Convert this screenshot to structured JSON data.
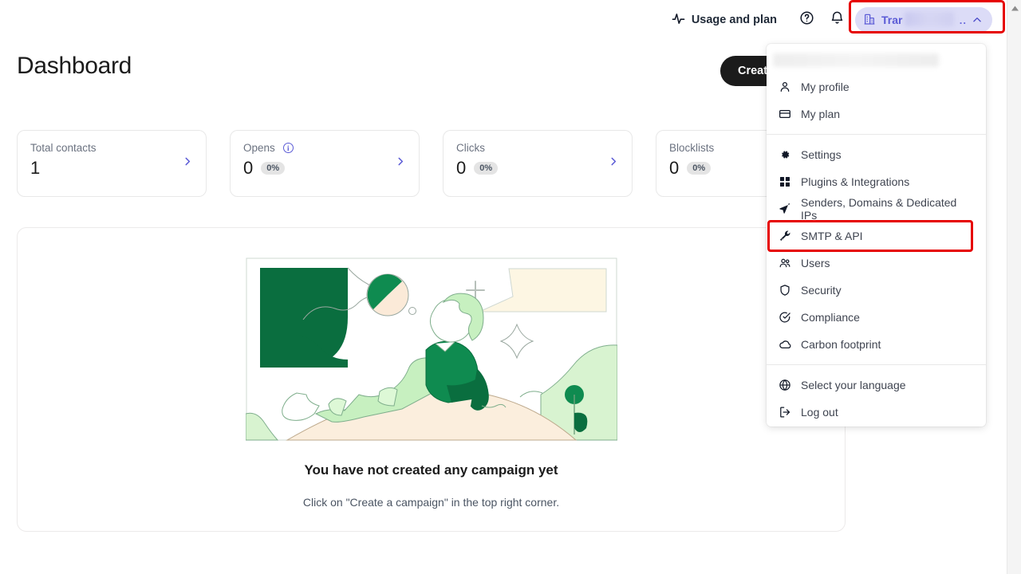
{
  "topbar": {
    "usage_and_plan": "Usage and plan",
    "usage_icon": "activity-pulse-icon",
    "help_icon": "help-circle-icon",
    "notifications_icon": "bell-icon",
    "account": {
      "icon": "company-building-icon",
      "label": "Trar",
      "truncation": "..",
      "caret_icon": "chevron-up-icon",
      "redacted": true
    }
  },
  "page": {
    "title": "Dashboard",
    "create_button": "Create a campaign"
  },
  "stats": [
    {
      "label": "Total contacts",
      "value": "1",
      "percent": null,
      "has_info": false,
      "chevron_icon": "chevron-right-icon"
    },
    {
      "label": "Opens",
      "value": "0",
      "percent": "0%",
      "has_info": true,
      "chevron_icon": "chevron-right-icon"
    },
    {
      "label": "Clicks",
      "value": "0",
      "percent": "0%",
      "has_info": false,
      "chevron_icon": "chevron-right-icon"
    },
    {
      "label": "Blocklists",
      "value": "0",
      "percent": "0%",
      "has_info": false,
      "chevron_icon": "chevron-right-icon"
    }
  ],
  "empty_state": {
    "title": "You have not created any campaign yet",
    "subtitle": "Click on \"Create a campaign\" in the top right corner.",
    "illustration": "person-sitting-on-hill-illustration"
  },
  "menu": {
    "account_name_redacted": "",
    "groups": [
      {
        "items": [
          {
            "label": "My profile",
            "icon": "person-icon",
            "highlighted": false
          },
          {
            "label": "My plan",
            "icon": "credit-card-icon",
            "highlighted": false
          }
        ]
      },
      {
        "items": [
          {
            "label": "Settings",
            "icon": "gear-icon",
            "highlighted": false
          },
          {
            "label": "Plugins & Integrations",
            "icon": "grid-squares-icon",
            "highlighted": false
          },
          {
            "label": "Senders, Domains & Dedicated IPs",
            "icon": "paper-plane-icon",
            "highlighted": false
          },
          {
            "label": "SMTP & API",
            "icon": "wrench-icon",
            "highlighted": true
          },
          {
            "label": "Users",
            "icon": "people-icon",
            "highlighted": false
          },
          {
            "label": "Security",
            "icon": "shield-icon",
            "highlighted": false
          },
          {
            "label": "Compliance",
            "icon": "check-circle-icon",
            "highlighted": false
          },
          {
            "label": "Carbon footprint",
            "icon": "cloud-icon",
            "highlighted": false
          }
        ]
      },
      {
        "items": [
          {
            "label": "Select your language",
            "icon": "globe-icon",
            "highlighted": false
          },
          {
            "label": "Log out",
            "icon": "logout-icon",
            "highlighted": false
          }
        ]
      }
    ]
  },
  "colors": {
    "accent_purple": "#5b5bd6",
    "chip_background": "#dcdcf7",
    "highlight_red": "#e60000",
    "button_dark": "#1b1b1b",
    "illustration_green_dark": "#0a6e3f",
    "illustration_green_light": "#c7f0c0",
    "illustration_cream": "#fdf6e3"
  },
  "scrollbar": {
    "arrow_icon": "scroll-up-arrow-icon"
  }
}
